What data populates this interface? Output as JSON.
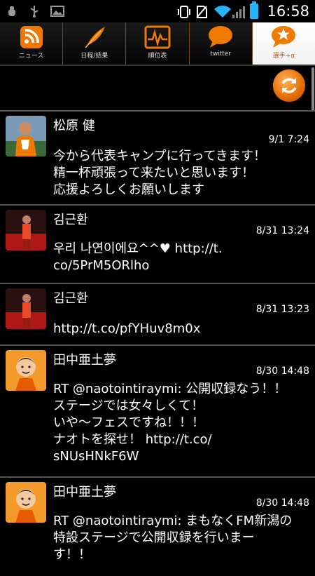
{
  "status_bar": {
    "time": "16:58",
    "icons": [
      "debug-icon",
      "usb-icon",
      "image-icon",
      "vibrate-icon",
      "no-sim-icon",
      "wifi-icon",
      "signal-icon",
      "battery-icon"
    ]
  },
  "tabs": [
    {
      "label": "ニュース",
      "icon": "rss-icon"
    },
    {
      "label": "日程/結果",
      "icon": "feather-icon"
    },
    {
      "label": "順位表",
      "icon": "chart-icon"
    },
    {
      "label": "twitter",
      "icon": "speech-bubble-icon"
    },
    {
      "label": "選手+α",
      "icon": "star-bubble-icon"
    }
  ],
  "colors": {
    "accent": "#f07a00",
    "active_tab_bg": "#ffffff"
  },
  "feed": [
    {
      "name": "松原 健",
      "time": "9/1 7:24",
      "text": "今から代表キャンプに行ってきます！\n精一杯頑張って来たいと思います！\n応援よろしくお願いします"
    },
    {
      "name": "김근환",
      "time": "8/31 13:24",
      "text": "우리 나연이에요^^♥ http://t.\nco/5PrM5ORlho"
    },
    {
      "name": "김근환",
      "time": "8/31 13:23",
      "text": "http://t.co/pfYHuv8m0x"
    },
    {
      "name": "田中亜土夢",
      "time": "8/30 14:48",
      "text": "RT @naotointiraymi: 公開収録なう！！\nステージでは女々しくて！\nいや〜フェスですね！！！\nナオトを探せ！ http://t.co/\nsNUsHNkF6W"
    },
    {
      "name": "田中亜土夢",
      "time": "8/30 14:48",
      "text": "RT @naotointiraymi: まもなくFM新潟の\n特設ステージで公開収録を行いまー\nす！！"
    }
  ]
}
